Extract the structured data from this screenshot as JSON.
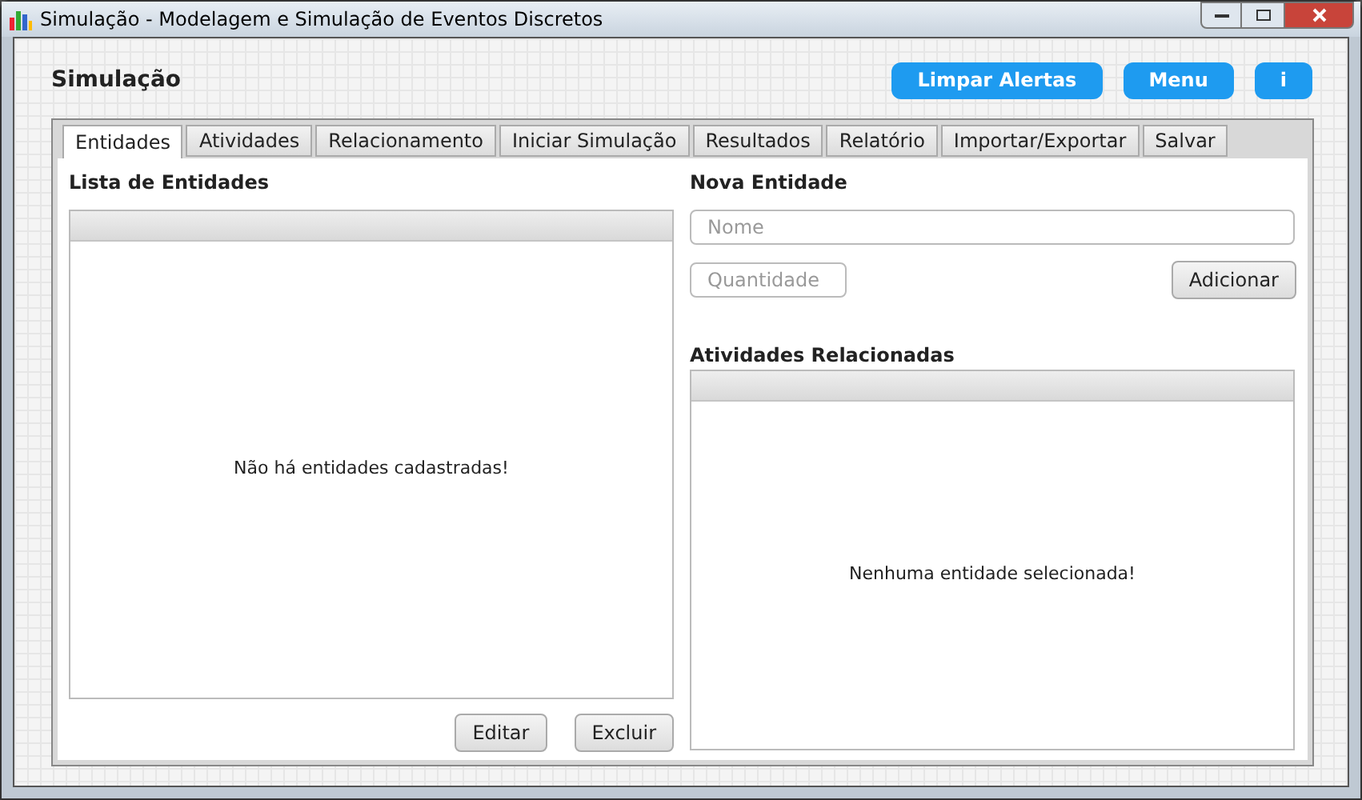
{
  "window": {
    "title": "Simulação - Modelagem e Simulação de Eventos Discretos"
  },
  "header": {
    "title": "Simulação",
    "buttons": [
      "Limpar Alertas",
      "Menu",
      "i"
    ]
  },
  "tabs": [
    {
      "label": "Entidades",
      "selected": true
    },
    {
      "label": "Atividades",
      "selected": false
    },
    {
      "label": "Relacionamento",
      "selected": false
    },
    {
      "label": "Iniciar Simulação",
      "selected": false
    },
    {
      "label": "Resultados",
      "selected": false
    },
    {
      "label": "Relatório",
      "selected": false
    },
    {
      "label": "Importar/Exportar",
      "selected": false
    },
    {
      "label": "Salvar",
      "selected": false
    }
  ],
  "entity_list": {
    "title": "Lista de Entidades",
    "empty_message": "Não há entidades cadastradas!",
    "buttons": [
      "Editar",
      "Excluir"
    ]
  },
  "new_entity": {
    "title": "Nova Entidade",
    "name_field": {
      "placeholder": "Nome"
    },
    "quantity_field": {
      "placeholder": "Quantidade"
    },
    "button": "Adicionar"
  },
  "related_activities": {
    "title": "Atividades Relacionadas",
    "empty_message": "Nenhuma entidade selecionada!"
  }
}
